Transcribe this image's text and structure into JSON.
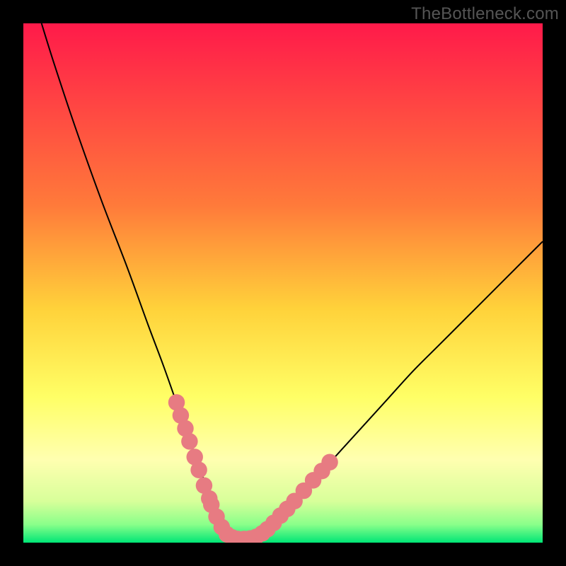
{
  "watermark": "TheBottleneck.com",
  "chart_data": {
    "type": "line",
    "title": "",
    "xlabel": "",
    "ylabel": "",
    "x_range": [
      0,
      100
    ],
    "y_range": [
      0,
      100
    ],
    "background_gradient": {
      "stops": [
        {
          "offset": 0,
          "color": "#ff1a4a"
        },
        {
          "offset": 0.35,
          "color": "#ff7a3a"
        },
        {
          "offset": 0.55,
          "color": "#ffd23a"
        },
        {
          "offset": 0.72,
          "color": "#ffff66"
        },
        {
          "offset": 0.84,
          "color": "#ffffb0"
        },
        {
          "offset": 0.92,
          "color": "#d8ff9a"
        },
        {
          "offset": 0.965,
          "color": "#8aff8a"
        },
        {
          "offset": 1.0,
          "color": "#00e676"
        }
      ]
    },
    "series": [
      {
        "name": "curve",
        "x": [
          3.5,
          6,
          10,
          15,
          20,
          24,
          27,
          30,
          33,
          35,
          37,
          38.8,
          40,
          41.5,
          43,
          45,
          47,
          50,
          55,
          60,
          65,
          70,
          75,
          80,
          85,
          90,
          95,
          100
        ],
        "y": [
          100,
          92,
          80,
          66,
          53,
          42,
          34,
          25.5,
          17,
          11.5,
          6.5,
          2.5,
          1.2,
          0.7,
          0.7,
          1.2,
          2.5,
          5.5,
          11,
          16.5,
          22,
          27.5,
          33,
          38,
          43,
          48,
          53,
          58
        ]
      }
    ],
    "markers": {
      "color": "#e77b82",
      "radius": 1.6,
      "points": [
        {
          "x": 29.5,
          "y": 27
        },
        {
          "x": 30.3,
          "y": 24.5
        },
        {
          "x": 31.2,
          "y": 22
        },
        {
          "x": 32.0,
          "y": 19.5
        },
        {
          "x": 33.0,
          "y": 16.5
        },
        {
          "x": 33.8,
          "y": 14
        },
        {
          "x": 34.8,
          "y": 11
        },
        {
          "x": 35.8,
          "y": 8.5
        },
        {
          "x": 36.2,
          "y": 7.3
        },
        {
          "x": 37.2,
          "y": 5.0
        },
        {
          "x": 38.2,
          "y": 3.0
        },
        {
          "x": 39.2,
          "y": 1.6
        },
        {
          "x": 40.2,
          "y": 1.0
        },
        {
          "x": 41.3,
          "y": 0.7
        },
        {
          "x": 42.5,
          "y": 0.7
        },
        {
          "x": 43.7,
          "y": 0.8
        },
        {
          "x": 44.8,
          "y": 1.1
        },
        {
          "x": 46.0,
          "y": 1.8
        },
        {
          "x": 47.0,
          "y": 2.6
        },
        {
          "x": 48.2,
          "y": 3.8
        },
        {
          "x": 49.5,
          "y": 5.2
        },
        {
          "x": 50.8,
          "y": 6.5
        },
        {
          "x": 52.2,
          "y": 8.0
        },
        {
          "x": 54.0,
          "y": 10.0
        },
        {
          "x": 55.8,
          "y": 12.0
        },
        {
          "x": 57.5,
          "y": 13.8
        },
        {
          "x": 59.0,
          "y": 15.5
        }
      ]
    }
  }
}
